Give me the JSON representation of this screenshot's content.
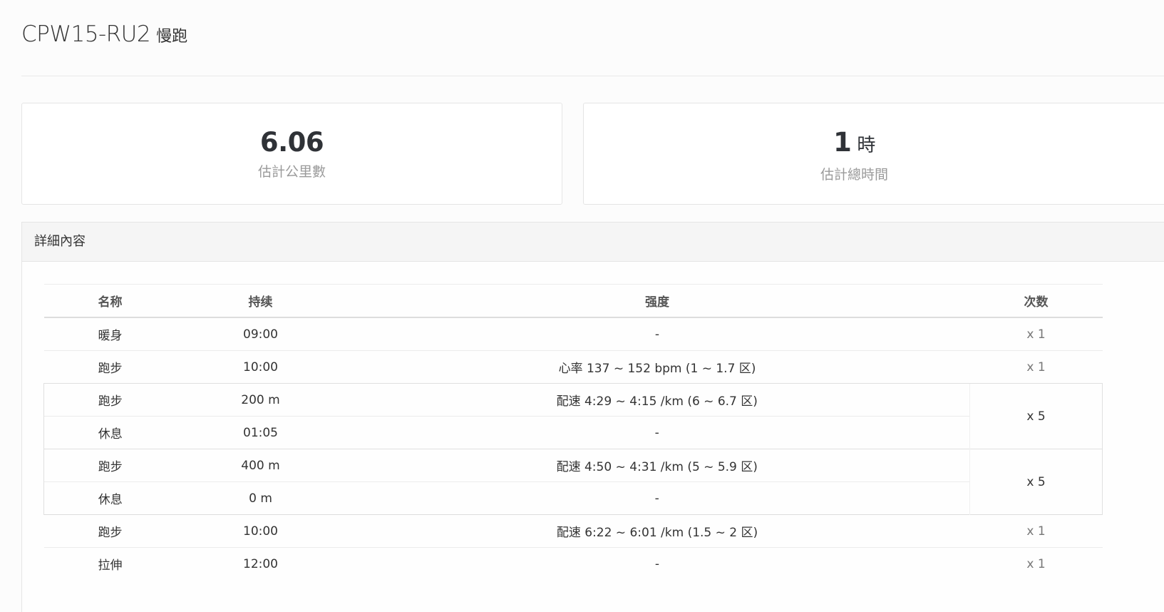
{
  "title": {
    "code": "CPW15-RU2",
    "type": "慢跑"
  },
  "stats": {
    "distance": {
      "value": "6.06",
      "label": "估計公里數"
    },
    "time": {
      "value": "1",
      "unit": "時",
      "label": "估計總時間"
    }
  },
  "details": {
    "heading": "詳細內容",
    "columns": {
      "name": "名称",
      "duration": "持续",
      "intensity": "强度",
      "reps": "次数"
    },
    "rows": [
      {
        "name": "暖身",
        "duration": "09:00",
        "intensity": "-",
        "reps": "x 1"
      },
      {
        "name": "跑步",
        "duration": "10:00",
        "intensity": "心率 137 ~ 152 bpm (1 ~ 1.7 区)",
        "reps": "x 1"
      },
      {
        "name": "跑步",
        "duration": "200 m",
        "intensity": "配速 4:29 ~ 4:15 /km (6 ~ 6.7 区)",
        "reps": "x 5"
      },
      {
        "name": "休息",
        "duration": "01:05",
        "intensity": "-"
      },
      {
        "name": "跑步",
        "duration": "400 m",
        "intensity": "配速 4:50 ~ 4:31 /km (5 ~ 5.9 区)",
        "reps": "x 5"
      },
      {
        "name": "休息",
        "duration": "0 m",
        "intensity": "-"
      },
      {
        "name": "跑步",
        "duration": "10:00",
        "intensity": "配速 6:22 ~ 6:01 /km (1.5 ~ 2 区)",
        "reps": "x 1"
      },
      {
        "name": "拉伸",
        "duration": "12:00",
        "intensity": "-",
        "reps": "x 1"
      }
    ]
  }
}
